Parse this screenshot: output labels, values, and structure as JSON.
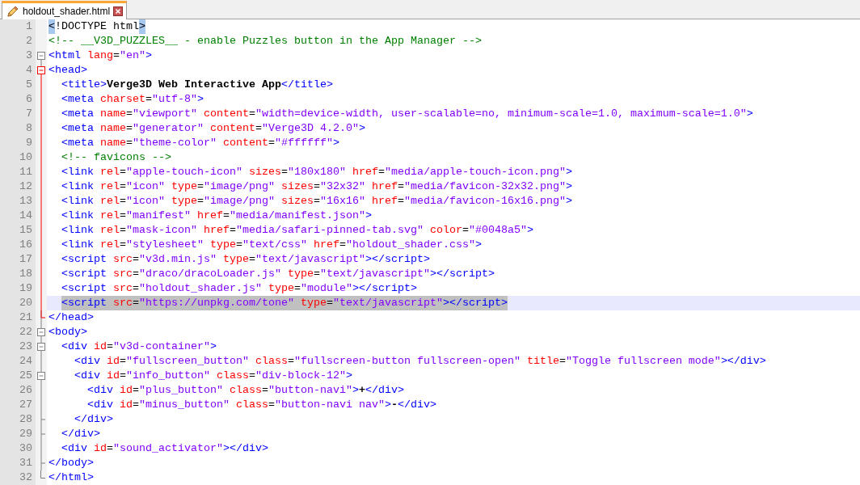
{
  "tabs": [
    {
      "label": "holdout_shader.html",
      "selected": true
    }
  ],
  "lines": [
    {
      "number": "1",
      "selected": false,
      "tokens": [
        {
          "kind": "match",
          "text": "<"
        },
        {
          "kind": "plain",
          "text": "!DOCTYPE html"
        },
        {
          "kind": "match",
          "text": ">"
        }
      ]
    },
    {
      "number": "2",
      "selected": false,
      "tokens": [
        {
          "kind": "comment",
          "text": "<!-- __V3D_PUZZLES__ - enable Puzzles button in the App Manager -->"
        }
      ]
    },
    {
      "number": "3",
      "kind": "start",
      "highlight": false,
      "selected": false,
      "tokens": [
        {
          "kind": "tag",
          "text": "<html "
        },
        {
          "kind": "attr",
          "text": "lang"
        },
        {
          "kind": "op",
          "text": "="
        },
        {
          "kind": "value",
          "text": "\"en\""
        },
        {
          "kind": "tag",
          "text": ">"
        }
      ]
    },
    {
      "number": "4",
      "kind": "start",
      "highlight": true,
      "selected": false,
      "tokens": [
        {
          "kind": "tag",
          "text": "<head>"
        }
      ],
      "children": [
        {
          "number": "5",
          "kind": "middle",
          "highlight": true,
          "selected": false,
          "tokens": [
            {
              "kind": "tag",
              "text": "<title>"
            },
            {
              "kind": "bold",
              "text": "Verge3D Web Interactive App"
            },
            {
              "kind": "tag",
              "text": "</title>"
            }
          ]
        },
        {
          "number": "6",
          "kind": "middle",
          "highlight": true,
          "selected": false,
          "tokens": [
            {
              "kind": "tag",
              "text": "<meta "
            },
            {
              "kind": "attr",
              "text": "charset"
            },
            {
              "kind": "op",
              "text": "="
            },
            {
              "kind": "value",
              "text": "\"utf-8\""
            },
            {
              "kind": "tag",
              "text": ">"
            }
          ]
        },
        {
          "number": "7",
          "kind": "middle",
          "highlight": true,
          "selected": false,
          "tokens": [
            {
              "kind": "tag",
              "text": "<meta "
            },
            {
              "kind": "attr",
              "text": "name"
            },
            {
              "kind": "op",
              "text": "="
            },
            {
              "kind": "value",
              "text": "\"viewport\" "
            },
            {
              "kind": "attr",
              "text": "content"
            },
            {
              "kind": "op",
              "text": "="
            },
            {
              "kind": "value",
              "text": "\"width=device-width, user-scalable=no, minimum-scale=1.0, maximum-scale=1.0\""
            },
            {
              "kind": "tag",
              "text": ">"
            }
          ]
        },
        {
          "number": "8",
          "kind": "middle",
          "highlight": true,
          "selected": false,
          "tokens": [
            {
              "kind": "tag",
              "text": "<meta "
            },
            {
              "kind": "attr",
              "text": "name"
            },
            {
              "kind": "op",
              "text": "="
            },
            {
              "kind": "value",
              "text": "\"generator\" "
            },
            {
              "kind": "attr",
              "text": "content"
            },
            {
              "kind": "op",
              "text": "="
            },
            {
              "kind": "value",
              "text": "\"Verge3D 4.2.0\""
            },
            {
              "kind": "tag",
              "text": ">"
            }
          ]
        },
        {
          "number": "9",
          "kind": "middle",
          "highlight": true,
          "selected": false,
          "tokens": [
            {
              "kind": "tag",
              "text": "<meta "
            },
            {
              "kind": "attr",
              "text": "name"
            },
            {
              "kind": "op",
              "text": "="
            },
            {
              "kind": "value",
              "text": "\"theme-color\" "
            },
            {
              "kind": "attr",
              "text": "content"
            },
            {
              "kind": "op",
              "text": "="
            },
            {
              "kind": "value",
              "text": "\"#ffffff\""
            },
            {
              "kind": "tag",
              "text": ">"
            }
          ]
        },
        {
          "number": "10",
          "kind": "middle",
          "highlight": true,
          "selected": false,
          "tokens": [
            {
              "kind": "comment",
              "text": "<!-- favicons -->"
            }
          ]
        },
        {
          "number": "11",
          "kind": "middle",
          "highlight": true,
          "selected": false,
          "tokens": [
            {
              "kind": "tag",
              "text": "<link "
            },
            {
              "kind": "attr",
              "text": "rel"
            },
            {
              "kind": "op",
              "text": "="
            },
            {
              "kind": "value",
              "text": "\"apple-touch-icon\" "
            },
            {
              "kind": "attr",
              "text": "sizes"
            },
            {
              "kind": "op",
              "text": "="
            },
            {
              "kind": "value",
              "text": "\"180x180\" "
            },
            {
              "kind": "attr",
              "text": "href"
            },
            {
              "kind": "op",
              "text": "="
            },
            {
              "kind": "value",
              "text": "\"media/apple-touch-icon.png\""
            },
            {
              "kind": "tag",
              "text": ">"
            }
          ]
        },
        {
          "number": "12",
          "kind": "middle",
          "highlight": true,
          "selected": false,
          "tokens": [
            {
              "kind": "tag",
              "text": "<link "
            },
            {
              "kind": "attr",
              "text": "rel"
            },
            {
              "kind": "op",
              "text": "="
            },
            {
              "kind": "value",
              "text": "\"icon\" "
            },
            {
              "kind": "attr",
              "text": "type"
            },
            {
              "kind": "op",
              "text": "="
            },
            {
              "kind": "value",
              "text": "\"image/png\" "
            },
            {
              "kind": "attr",
              "text": "sizes"
            },
            {
              "kind": "op",
              "text": "="
            },
            {
              "kind": "value",
              "text": "\"32x32\" "
            },
            {
              "kind": "attr",
              "text": "href"
            },
            {
              "kind": "op",
              "text": "="
            },
            {
              "kind": "value",
              "text": "\"media/favicon-32x32.png\""
            },
            {
              "kind": "tag",
              "text": ">"
            }
          ]
        },
        {
          "number": "13",
          "kind": "middle",
          "highlight": true,
          "selected": false,
          "tokens": [
            {
              "kind": "tag",
              "text": "<link "
            },
            {
              "kind": "attr",
              "text": "rel"
            },
            {
              "kind": "op",
              "text": "="
            },
            {
              "kind": "value",
              "text": "\"icon\" "
            },
            {
              "kind": "attr",
              "text": "type"
            },
            {
              "kind": "op",
              "text": "="
            },
            {
              "kind": "value",
              "text": "\"image/png\" "
            },
            {
              "kind": "attr",
              "text": "sizes"
            },
            {
              "kind": "op",
              "text": "="
            },
            {
              "kind": "value",
              "text": "\"16x16\" "
            },
            {
              "kind": "attr",
              "text": "href"
            },
            {
              "kind": "op",
              "text": "="
            },
            {
              "kind": "value",
              "text": "\"media/favicon-16x16.png\""
            },
            {
              "kind": "tag",
              "text": ">"
            }
          ]
        },
        {
          "number": "14",
          "kind": "middle",
          "highlight": true,
          "selected": false,
          "tokens": [
            {
              "kind": "tag",
              "text": "<link "
            },
            {
              "kind": "attr",
              "text": "rel"
            },
            {
              "kind": "op",
              "text": "="
            },
            {
              "kind": "value",
              "text": "\"manifest\" "
            },
            {
              "kind": "attr",
              "text": "href"
            },
            {
              "kind": "op",
              "text": "="
            },
            {
              "kind": "value",
              "text": "\"media/manifest.json\""
            },
            {
              "kind": "tag",
              "text": ">"
            }
          ]
        },
        {
          "number": "15",
          "kind": "middle",
          "highlight": true,
          "selected": false,
          "tokens": [
            {
              "kind": "tag",
              "text": "<link "
            },
            {
              "kind": "attr",
              "text": "rel"
            },
            {
              "kind": "op",
              "text": "="
            },
            {
              "kind": "value",
              "text": "\"mask-icon\" "
            },
            {
              "kind": "attr",
              "text": "href"
            },
            {
              "kind": "op",
              "text": "="
            },
            {
              "kind": "value",
              "text": "\"media/safari-pinned-tab.svg\" "
            },
            {
              "kind": "attr",
              "text": "color"
            },
            {
              "kind": "op",
              "text": "="
            },
            {
              "kind": "value",
              "text": "\"#0048a5\""
            },
            {
              "kind": "tag",
              "text": ">"
            }
          ]
        },
        {
          "number": "16",
          "kind": "middle",
          "highlight": true,
          "selected": false,
          "tokens": [
            {
              "kind": "tag",
              "text": "<link "
            },
            {
              "kind": "attr",
              "text": "rel"
            },
            {
              "kind": "op",
              "text": "="
            },
            {
              "kind": "value",
              "text": "\"stylesheet\" "
            },
            {
              "kind": "attr",
              "text": "type"
            },
            {
              "kind": "op",
              "text": "="
            },
            {
              "kind": "value",
              "text": "\"text/css\" "
            },
            {
              "kind": "attr",
              "text": "href"
            },
            {
              "kind": "op",
              "text": "="
            },
            {
              "kind": "value",
              "text": "\"holdout_shader.css\""
            },
            {
              "kind": "tag",
              "text": ">"
            }
          ]
        },
        {
          "number": "17",
          "kind": "middle",
          "highlight": true,
          "selected": false,
          "tokens": [
            {
              "kind": "tag",
              "text": "<script "
            },
            {
              "kind": "attr",
              "text": "src"
            },
            {
              "kind": "op",
              "text": "="
            },
            {
              "kind": "value",
              "text": "\"v3d.min.js\" "
            },
            {
              "kind": "attr",
              "text": "type"
            },
            {
              "kind": "op",
              "text": "="
            },
            {
              "kind": "value",
              "text": "\"text/javascript\""
            },
            {
              "kind": "tag",
              "text": "></script>"
            }
          ]
        },
        {
          "number": "18",
          "kind": "middle",
          "highlight": true,
          "selected": false,
          "tokens": [
            {
              "kind": "tag",
              "text": "<script "
            },
            {
              "kind": "attr",
              "text": "src"
            },
            {
              "kind": "op",
              "text": "="
            },
            {
              "kind": "value",
              "text": "\"draco/dracoLoader.js\" "
            },
            {
              "kind": "attr",
              "text": "type"
            },
            {
              "kind": "op",
              "text": "="
            },
            {
              "kind": "value",
              "text": "\"text/javascript\""
            },
            {
              "kind": "tag",
              "text": "></script>"
            }
          ]
        },
        {
          "number": "19",
          "kind": "middle",
          "highlight": true,
          "selected": false,
          "tokens": [
            {
              "kind": "tag",
              "text": "<script "
            },
            {
              "kind": "attr",
              "text": "src"
            },
            {
              "kind": "op",
              "text": "="
            },
            {
              "kind": "value",
              "text": "\"holdout_shader.js\" "
            },
            {
              "kind": "attr",
              "text": "type"
            },
            {
              "kind": "op",
              "text": "="
            },
            {
              "kind": "value",
              "text": "\"module\""
            },
            {
              "kind": "tag",
              "text": "></script>"
            }
          ]
        },
        {
          "number": "20",
          "kind": "middle",
          "highlight": true,
          "selected": true,
          "tokens": [
            {
              "kind": "tag",
              "text": "<script "
            },
            {
              "kind": "attr",
              "text": "src"
            },
            {
              "kind": "op",
              "text": "="
            },
            {
              "kind": "value",
              "text": "\"https://unpkg.com/tone\" "
            },
            {
              "kind": "attr",
              "text": "type"
            },
            {
              "kind": "op",
              "text": "="
            },
            {
              "kind": "value",
              "text": "\"text/javascript\""
            },
            {
              "kind": "tag",
              "text": "></script>"
            }
          ]
        }
      ]
    },
    {
      "number": "21",
      "kind": "end",
      "highlight": true,
      "selected": false,
      "tokens": [
        {
          "kind": "tag",
          "text": "</head>"
        }
      ]
    },
    {
      "number": "22",
      "kind": "start",
      "highlight": false,
      "selected": false,
      "tokens": [
        {
          "kind": "tag",
          "text": "<body>"
        }
      ],
      "children": [
        {
          "number": "23",
          "kind": "start",
          "highlight": false,
          "selected": false,
          "tokens": [
            {
              "kind": "tag",
              "text": "<div "
            },
            {
              "kind": "attr",
              "text": "id"
            },
            {
              "kind": "op",
              "text": "="
            },
            {
              "kind": "value",
              "text": "\"v3d-container\""
            },
            {
              "kind": "tag",
              "text": ">"
            }
          ],
          "children": [
            {
              "number": "24",
              "kind": "middle",
              "highlight": false,
              "selected": false,
              "tokens": [
                {
                  "kind": "tag",
                  "text": "<div "
                },
                {
                  "kind": "attr",
                  "text": "id"
                },
                {
                  "kind": "op",
                  "text": "="
                },
                {
                  "kind": "value",
                  "text": "\"fullscreen_button\" "
                },
                {
                  "kind": "attr",
                  "text": "class"
                },
                {
                  "kind": "op",
                  "text": "="
                },
                {
                  "kind": "value",
                  "text": "\"fullscreen-button fullscreen-open\" "
                },
                {
                  "kind": "attr",
                  "text": "title"
                },
                {
                  "kind": "op",
                  "text": "="
                },
                {
                  "kind": "value",
                  "text": "\"Toggle fullscreen mode\""
                },
                {
                  "kind": "tag",
                  "text": "></div>"
                }
              ]
            },
            {
              "number": "25",
              "kind": "start",
              "highlight": false,
              "selected": false,
              "tokens": [
                {
                  "kind": "tag",
                  "text": "<div "
                },
                {
                  "kind": "attr",
                  "text": "id"
                },
                {
                  "kind": "op",
                  "text": "="
                },
                {
                  "kind": "value",
                  "text": "\"info_button\" "
                },
                {
                  "kind": "attr",
                  "text": "class"
                },
                {
                  "kind": "op",
                  "text": "="
                },
                {
                  "kind": "value",
                  "text": "\"div-block-12\""
                },
                {
                  "kind": "tag",
                  "text": ">"
                }
              ],
              "children": [
                {
                  "number": "26",
                  "kind": "middle",
                  "highlight": false,
                  "selected": false,
                  "tokens": [
                    {
                      "kind": "tag",
                      "text": "<div "
                    },
                    {
                      "kind": "attr",
                      "text": "id"
                    },
                    {
                      "kind": "op",
                      "text": "="
                    },
                    {
                      "kind": "value",
                      "text": "\"plus_button\" "
                    },
                    {
                      "kind": "attr",
                      "text": "class"
                    },
                    {
                      "kind": "op",
                      "text": "="
                    },
                    {
                      "kind": "value",
                      "text": "\"button-navi\""
                    },
                    {
                      "kind": "tag",
                      "text": ">"
                    },
                    {
                      "kind": "bold",
                      "text": "+"
                    },
                    {
                      "kind": "tag",
                      "text": "</div>"
                    }
                  ]
                },
                {
                  "number": "27",
                  "kind": "middle",
                  "highlight": false,
                  "selected": false,
                  "tokens": [
                    {
                      "kind": "tag",
                      "text": "<div "
                    },
                    {
                      "kind": "attr",
                      "text": "id"
                    },
                    {
                      "kind": "op",
                      "text": "="
                    },
                    {
                      "kind": "value",
                      "text": "\"minus_button\" "
                    },
                    {
                      "kind": "attr",
                      "text": "class"
                    },
                    {
                      "kind": "op",
                      "text": "="
                    },
                    {
                      "kind": "value",
                      "text": "\"button-navi nav\""
                    },
                    {
                      "kind": "tag",
                      "text": ">"
                    },
                    {
                      "kind": "bold",
                      "text": "-"
                    },
                    {
                      "kind": "tag",
                      "text": "</div>"
                    }
                  ]
                }
              ]
            },
            {
              "number": "28",
              "kind": "end",
              "highlight": false,
              "selected": false,
              "tokens": [
                {
                  "kind": "tag",
                  "text": "</div>"
                }
              ]
            }
          ]
        },
        {
          "number": "29",
          "kind": "end",
          "highlight": false,
          "selected": false,
          "tokens": [
            {
              "kind": "tag",
              "text": "</div>"
            }
          ]
        },
        {
          "number": "30",
          "kind": "middle",
          "highlight": false,
          "selected": false,
          "tokens": [
            {
              "kind": "tag",
              "text": "<div "
            },
            {
              "kind": "attr",
              "text": "id"
            },
            {
              "kind": "op",
              "text": "="
            },
            {
              "kind": "value",
              "text": "\"sound_activator\""
            },
            {
              "kind": "tag",
              "text": "></div>"
            }
          ]
        }
      ]
    },
    {
      "number": "31",
      "kind": "end",
      "highlight": false,
      "selected": false,
      "tokens": [
        {
          "kind": "tag",
          "text": "</body>"
        }
      ]
    },
    {
      "number": "32",
      "kind": "last",
      "highlight": false,
      "selected": false,
      "tokens": [
        {
          "kind": "tag",
          "text": "</html>"
        }
      ]
    }
  ]
}
